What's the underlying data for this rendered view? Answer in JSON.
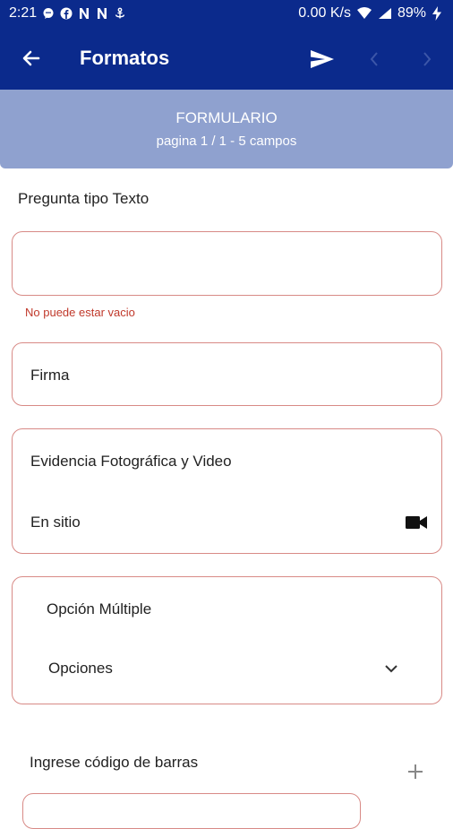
{
  "status_bar": {
    "time": "2:21",
    "network_speed": "0.00 K/s",
    "battery_percent": "89%",
    "icons_left": [
      "message-icon",
      "facebook-icon",
      "notification-n-icon",
      "notification-n-icon",
      "anchor-icon"
    ],
    "icons_right": [
      "wifi-icon",
      "signal-icon",
      "battery-charging-icon"
    ]
  },
  "app_bar": {
    "title": "Formatos",
    "back_icon": "arrow-left-icon",
    "send_icon": "send-icon",
    "prev_icon": "chevron-left-icon",
    "next_icon": "chevron-right-icon"
  },
  "banner": {
    "title": "FORMULARIO",
    "subtitle": "pagina 1 / 1 - 5 campos"
  },
  "form": {
    "text_question": {
      "label": "Pregunta tipo Texto",
      "value": "",
      "error": "No puede estar vacio"
    },
    "signature": {
      "label": "Firma"
    },
    "evidence": {
      "label": "Evidencia Fotográfica y Video",
      "mode": "En sitio",
      "icon": "video-camera-icon"
    },
    "multiple_choice": {
      "label": "Opción Múltiple",
      "selected": "Opciones",
      "icon": "chevron-down-icon"
    },
    "barcode": {
      "label": "Ingrese código de barras",
      "icon": "plus-icon"
    }
  },
  "colors": {
    "primary": "#0b2a8c",
    "banner": "#8fa1cf",
    "field_border": "#d88a86",
    "error_text": "#c0392b"
  }
}
